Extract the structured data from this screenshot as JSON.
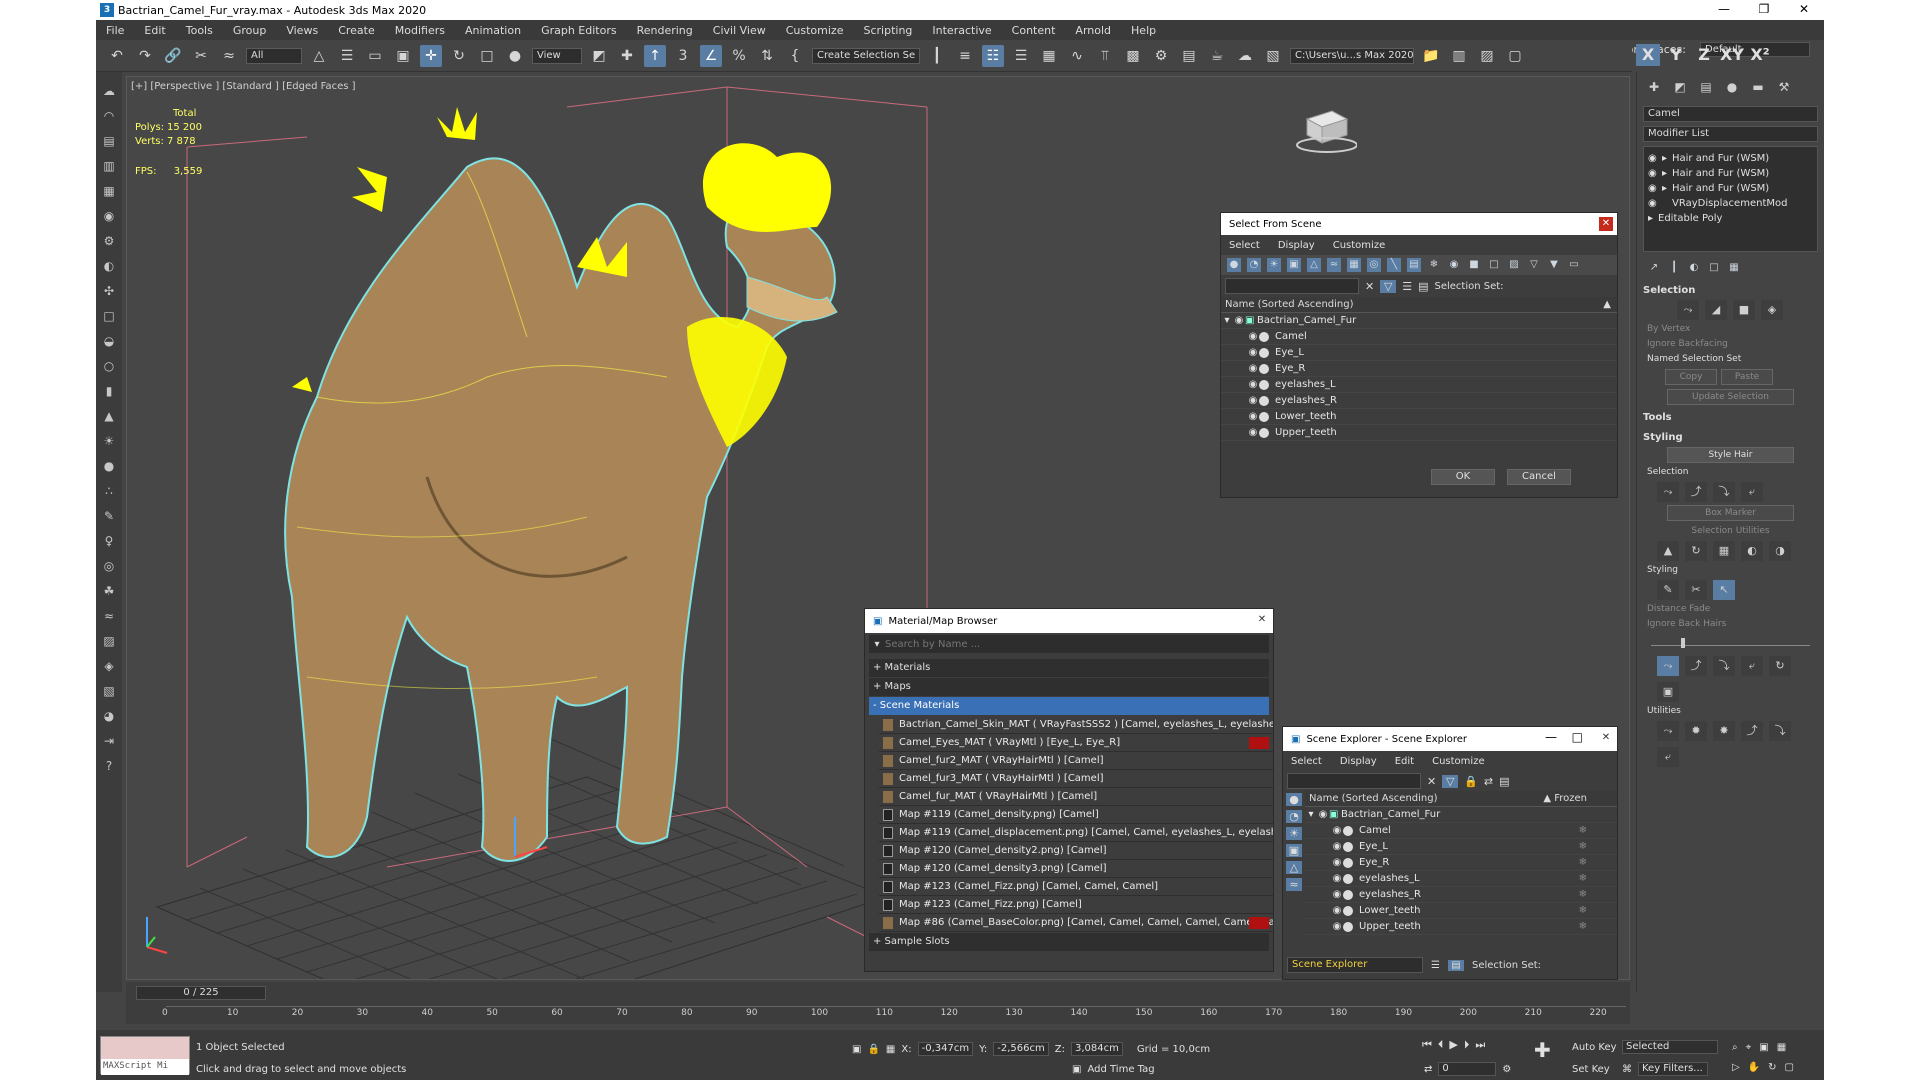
{
  "window": {
    "title": "Bactrian_Camel_Fur_vray.max - Autodesk 3ds Max 2020",
    "app_icon": "3",
    "controls": [
      "—",
      "❐",
      "✕"
    ]
  },
  "menu": [
    "File",
    "Edit",
    "Tools",
    "Group",
    "Views",
    "Create",
    "Modifiers",
    "Animation",
    "Graph Editors",
    "Rendering",
    "Civil View",
    "Customize",
    "Scripting",
    "Interactive",
    "Content",
    "Arnold",
    "Help"
  ],
  "workspace": {
    "label": "Workspaces:",
    "value": "Default"
  },
  "toolbar": {
    "filter_value": "All",
    "ref_coord_value": "View",
    "selection_set_value": "Create Selection Se",
    "project_path": "C:\\Users\\u...s Max 2020",
    "axis_buttons": [
      "X",
      "Y",
      "Z",
      "XY",
      "X²"
    ]
  },
  "viewport": {
    "label": "[+] [Perspective ] [Standard ] [Edged Faces ]",
    "stats_total_label": "Total",
    "stats": [
      {
        "k": "Polys:",
        "v": "15 200"
      },
      {
        "k": "Verts:",
        "v": "7 878"
      }
    ],
    "fps_label": "FPS:",
    "fps_value": "3,559"
  },
  "select_from_scene": {
    "title": "Select From Scene",
    "menu": [
      "Select",
      "Display",
      "Customize"
    ],
    "selection_set_label": "Selection Set:",
    "column_header": "Name (Sorted Ascending)",
    "root": "Bactrian_Camel_Fur",
    "items": [
      "Camel",
      "Eye_L",
      "Eye_R",
      "eyelashes_L",
      "eyelashes_R",
      "Lower_teeth",
      "Upper_teeth"
    ],
    "ok_label": "OK",
    "cancel_label": "Cancel"
  },
  "material_browser": {
    "title": "Material/Map Browser",
    "search_placeholder": "Search by Name ...",
    "sections": {
      "materials": "+ Materials",
      "maps": "+ Maps",
      "scene_materials": "- Scene Materials",
      "sample_slots": "+ Sample Slots"
    },
    "scene_items": [
      {
        "label": "Bactrian_Camel_Skin_MAT  ( VRayFastSSS2 )  [Camel, eyelashes_L, eyelashe...",
        "kind": "mat"
      },
      {
        "label": "Camel_Eyes_MAT  ( VRayMtl )  [Eye_L, Eye_R]",
        "kind": "mat",
        "red": true
      },
      {
        "label": "Camel_fur2_MAT  ( VRayHairMtl )  [Camel]",
        "kind": "mat"
      },
      {
        "label": "Camel_fur3_MAT  ( VRayHairMtl )  [Camel]",
        "kind": "mat"
      },
      {
        "label": "Camel_fur_MAT  ( VRayHairMtl )  [Camel]",
        "kind": "mat"
      },
      {
        "label": "Map #119 (Camel_density.png)  [Camel]",
        "kind": "map"
      },
      {
        "label": "Map #119 (Camel_displacement.png)  [Camel, Camel, eyelashes_L, eyelashe...",
        "kind": "map"
      },
      {
        "label": "Map #120 (Camel_density2.png)  [Camel]",
        "kind": "map"
      },
      {
        "label": "Map #120 (Camel_density3.png)  [Camel]",
        "kind": "map"
      },
      {
        "label": "Map #123 (Camel_Fizz.png)  [Camel, Camel, Camel]",
        "kind": "map"
      },
      {
        "label": "Map #123 (Camel_Fizz.png)  [Camel]",
        "kind": "map"
      },
      {
        "label": "Map #86 (Camel_BaseColor.png)  [Camel, Camel, Camel, Camel, Camel, Ca...",
        "kind": "mat",
        "red": true
      }
    ]
  },
  "scene_explorer": {
    "title": "Scene Explorer - Scene Explorer",
    "menu": [
      "Select",
      "Display",
      "Edit",
      "Customize"
    ],
    "column_header": "Name (Sorted Ascending)",
    "frozen_header": "▲ Frozen",
    "root": "Bactrian_Camel_Fur",
    "items": [
      "Camel",
      "Eye_L",
      "Eye_R",
      "eyelashes_L",
      "eyelashes_R",
      "Lower_teeth",
      "Upper_teeth"
    ],
    "footer_dropdown": "Scene Explorer",
    "selection_set_label": "Selection Set:"
  },
  "command_panel": {
    "object_name": "Camel",
    "modifier_list": "Modifier List",
    "stack": [
      "Hair and Fur (WSM)",
      "Hair and Fur (WSM)",
      "Hair and Fur (WSM)",
      "VRayDisplacementMod",
      "Editable Poly"
    ],
    "selection_title": "Selection",
    "by_vertex": "By Vertex",
    "ignore_backfacing": "Ignore Backfacing",
    "named_selection_set": "Named Selection Set",
    "copy": "Copy",
    "paste": "Paste",
    "update_selection": "Update Selection",
    "tools_title": "Tools",
    "styling_title": "Styling",
    "style_hair": "Style Hair",
    "sel_sub": "Selection",
    "box_marker": "Box Marker",
    "selection_utilities": "Selection Utilities",
    "styling_sub": "Styling",
    "distance_fade": "Distance Fade",
    "ignore_back_hairs": "Ignore Back Hairs",
    "utilities_sub": "Utilities"
  },
  "timeline": {
    "slider": "0 / 225",
    "ticks": [
      "0",
      "10",
      "20",
      "30",
      "40",
      "50",
      "60",
      "70",
      "80",
      "90",
      "100",
      "110",
      "120",
      "130",
      "140",
      "150",
      "160",
      "170",
      "180",
      "190",
      "200",
      "210",
      "220"
    ]
  },
  "status": {
    "maxscript": "MAXScript Mi",
    "selected": "1 Object Selected",
    "hint": "Click and drag to select and move objects",
    "x_label": "X:",
    "x": "-0,347cm",
    "y_label": "Y:",
    "y": "-2,566cm",
    "z_label": "Z:",
    "z": "3,084cm",
    "grid": "Grid = 10,0cm",
    "add_time_tag": "Add Time Tag",
    "frame": "0",
    "auto_key": "Auto Key",
    "set_key": "Set Key",
    "selected_dropdown": "Selected",
    "key_filters": "Key Filters..."
  },
  "colors": {
    "accent": "#5a7ea3",
    "fur_highlight": "#ffff00",
    "scene_bg": "#474747",
    "close_red": "#c42b1c"
  }
}
